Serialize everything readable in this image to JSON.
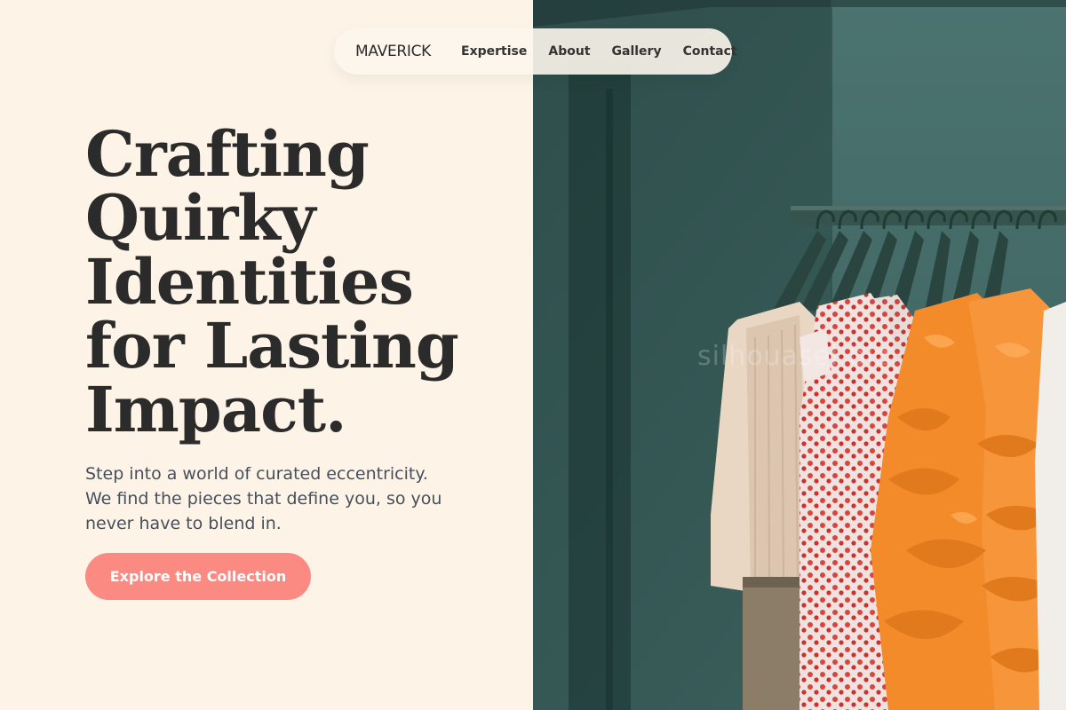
{
  "nav": {
    "brand": "MAVERICK",
    "links": [
      "Expertise",
      "About",
      "Gallery",
      "Contact"
    ]
  },
  "hero": {
    "title_lines": [
      "Crafting",
      "Quirky",
      "Identities",
      "for Lasting",
      "Impact."
    ],
    "subtitle": "Step into a world of curated eccentricity. We find the pieces that define you, so you never have to blend in.",
    "cta_label": "Explore the Collection"
  },
  "image": {
    "watermark": "silhouasel.biz"
  },
  "colors": {
    "background": "#fdf4e7",
    "accent": "#fa8a82",
    "text": "#2b2b2b",
    "wall": "#3f6460",
    "orange": "#f48b2a"
  }
}
